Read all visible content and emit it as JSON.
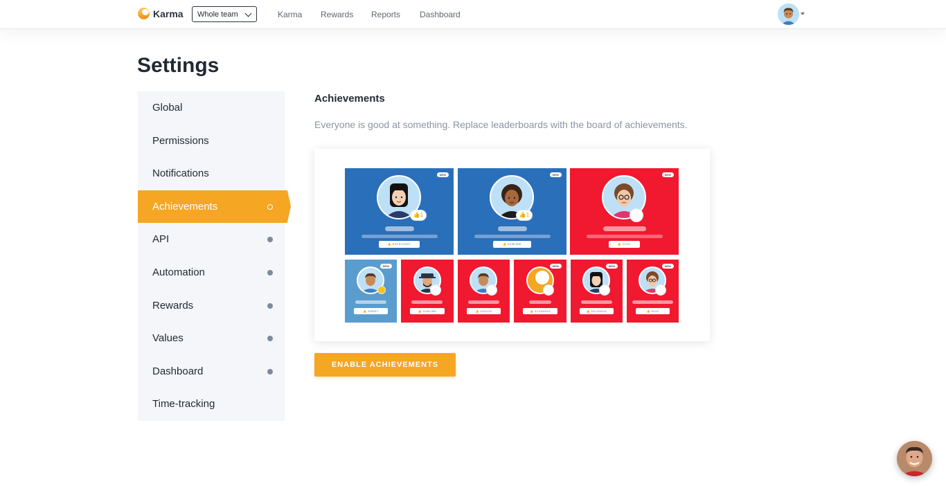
{
  "header": {
    "logo_text": "Karma",
    "team_select": "Whole team",
    "nav": [
      "Karma",
      "Rewards",
      "Reports",
      "Dashboard"
    ]
  },
  "page": {
    "title": "Settings"
  },
  "sidebar": {
    "items": [
      {
        "label": "Global",
        "dot": false
      },
      {
        "label": "Permissions",
        "dot": false
      },
      {
        "label": "Notifications",
        "dot": false
      },
      {
        "label": "Achievements",
        "dot": true,
        "active": true
      },
      {
        "label": "API",
        "dot": true
      },
      {
        "label": "Automation",
        "dot": true
      },
      {
        "label": "Rewards",
        "dot": true
      },
      {
        "label": "Values",
        "dot": true
      },
      {
        "label": "Dashboard",
        "dot": true
      },
      {
        "label": "Time-tracking",
        "dot": false
      }
    ]
  },
  "main": {
    "section_title": "Achievements",
    "description": "Everyone is good at something. Replace leaderboards with the board of achievements.",
    "preview": {
      "new_label": "NEW",
      "large_cards": [
        {
          "tag": "👍 EXCELLENT",
          "color": "#2a6fba",
          "count": "👍1",
          "new": true
        },
        {
          "tag": "👍 SUBLIME",
          "color": "#2a6fba",
          "count": "👍1",
          "new": true
        },
        {
          "tag": "👍 COOL",
          "color": "#f0192f",
          "new": true
        }
      ],
      "small_cards": [
        {
          "tag": "👍 SWEET",
          "color": "#5b9ccf",
          "new": true
        },
        {
          "tag": "👍 SUBLIME",
          "color": "#f0192f",
          "new": false
        },
        {
          "tag": "👍 CHOICE",
          "color": "#f0192f",
          "new": false
        },
        {
          "tag": "👍 STUNNING",
          "color": "#f0192f",
          "new": true
        },
        {
          "tag": "👍 SPLENDID",
          "color": "#f0192f",
          "new": true
        },
        {
          "tag": "👍 NICE",
          "color": "#f0192f",
          "new": true
        }
      ]
    },
    "enable_button": "ENABLE ACHIEVEMENTS"
  },
  "colors": {
    "accent": "#f5a623",
    "blue": "#2a6fba",
    "red": "#f0192f",
    "sidebar_bg": "#f4f6f9"
  }
}
